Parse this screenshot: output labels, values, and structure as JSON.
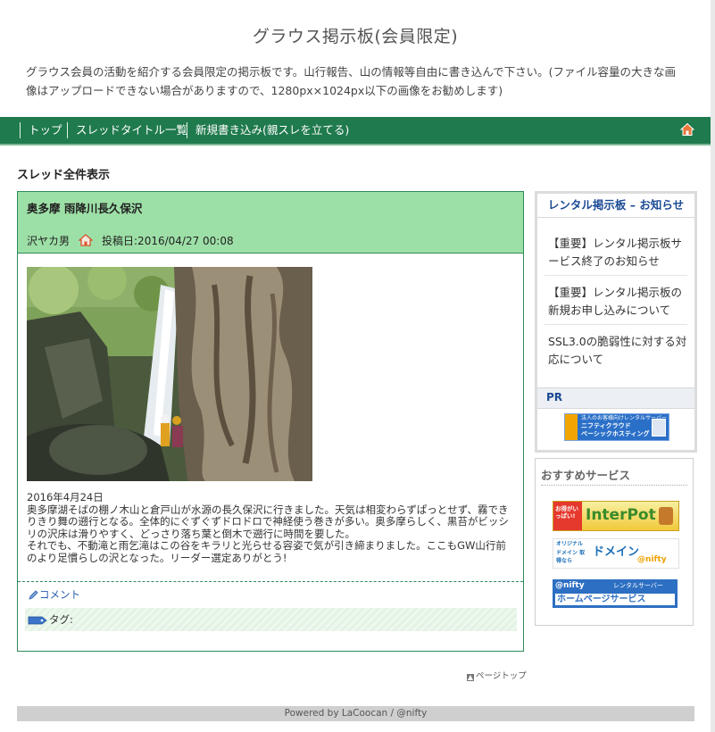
{
  "site": {
    "title": "グラウス掲示板(会員限定)",
    "description": "グラウス会員の活動を紹介する会員限定の掲示板です。山行報告、山の情報等自由に書き込んで下さい。(ファイル容量の大きな画像はアップロードできない場合がありますので、1280px×1024px以下の画像をお勧めします)"
  },
  "nav": {
    "items": [
      "トップ",
      "スレッドタイトル一覧",
      "新規書き込み(親スレを立てる)"
    ],
    "home_icon": "home-icon"
  },
  "section_title": "スレッド全件表示",
  "post": {
    "title": "奥多摩 雨降川長久保沢",
    "author": "沢ヤカ男",
    "date_label": "投稿日:2016/04/27 00:08",
    "body_date": "2016年4月24日",
    "body": "奥多摩湖そばの棚ノ木山と倉戸山が水源の長久保沢に行きました。天気は相変わらずぱっとせず、霧できりきり舞の遡行となる。全体的にぐずぐずドロドロで神経使う巻きが多い。奥多摩らしく、黒苔がビッシリの沢床は滑りやすく、どっさり落ち葉と倒木で遡行に時間を要した。",
    "body2": "それでも、不動滝と雨乞滝はこの谷をキラリと光らせる容姿で気が引き締まりました。ここもGW山行前のより足慣らしの沢となった。リーダー選定ありがとう!",
    "comment_label": "コメント",
    "tag_label": "タグ:"
  },
  "pagetop": "ページトップ",
  "footer": "Powered by LaCoocan / @nifty",
  "sidebar": {
    "notice_title": "レンタル掲示板 – お知らせ",
    "notices": [
      "【重要】レンタル掲示板サービス終了のお知らせ",
      "【重要】レンタル掲示板の新規お申し込みについて",
      "SSL3.0の脆弱性に対する対応について"
    ],
    "pr_label": "PR",
    "pr_banner": {
      "line1": "法人のお客様向けレンタルサーバー",
      "line2": "ニフティクラウド",
      "line3": "ベーシックホスティング"
    },
    "recommend_title": "おすすめサービス",
    "banners": [
      {
        "line1": "お得がいっぱい!",
        "line2": "InterPot"
      },
      {
        "line1": "オリジナル ドメイン 取得なら",
        "line2": "ドメイン",
        "line3": "@nifty"
      },
      {
        "line1": "@nifty",
        "line2": "レンタルサーバー",
        "line3": "ホームページサービス"
      }
    ]
  },
  "colors": {
    "nav_bg": "#1f7a4d",
    "post_header": "#9de0a7",
    "post_border": "#2f8a5a",
    "link": "#2a5db0",
    "sidebar_title": "#1b4a94"
  }
}
